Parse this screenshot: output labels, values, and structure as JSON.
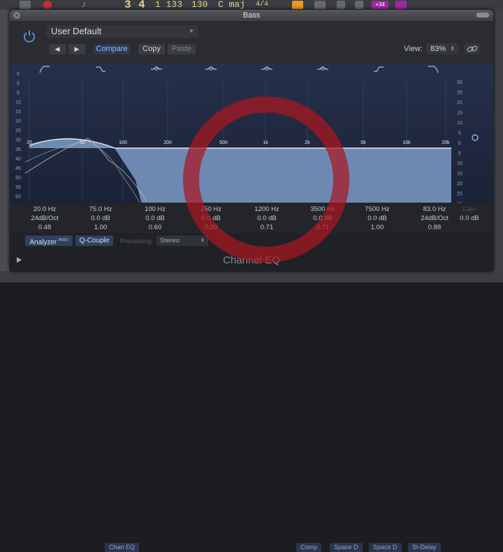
{
  "host": {
    "lcd": {
      "bar": "3",
      "beat": "4",
      "tempo": "1 133",
      "bpm": "130",
      "key": "C maj",
      "sig_top": "4",
      "sig_bottom": "4"
    },
    "badge": "+34",
    "strip_tabs": [
      "Chan EQ",
      "Comp",
      "Space D",
      "Space D",
      "St-Delay"
    ]
  },
  "window": {
    "title": "Bass"
  },
  "header": {
    "preset": "User Default",
    "prev_symbol": "◀",
    "next_symbol": "▶",
    "compare": "Compare",
    "copy": "Copy",
    "paste": "Paste",
    "view_label": "View:",
    "view_value": "83%",
    "view_arrows": "⬍"
  },
  "graph": {
    "y_left": [
      "0",
      "0",
      "5",
      "10",
      "15",
      "20",
      "25",
      "30",
      "35",
      "40",
      "45",
      "50",
      "55",
      "60"
    ],
    "y_right": [
      "30",
      "25",
      "20",
      "15",
      "10",
      "5",
      "0",
      "5",
      "10",
      "15",
      "20",
      "25",
      "30"
    ],
    "freq_labels": [
      "20",
      "50",
      "100",
      "200",
      "500",
      "1k",
      "2k",
      "5k",
      "10k",
      "20k"
    ],
    "band_icons": [
      "low-cut-icon",
      "low-shelf-icon",
      "bell-icon",
      "bell-icon",
      "bell-icon",
      "bell-icon",
      "high-shelf-icon",
      "high-cut-icon"
    ]
  },
  "bands": [
    {
      "freq": "20.0 Hz",
      "gain": "24dB/Oct",
      "q": "0.48"
    },
    {
      "freq": "75.0 Hz",
      "gain": "0.0 dB",
      "q": "1.00"
    },
    {
      "freq": "100 Hz",
      "gain": "0.0 dB",
      "q": "0.60"
    },
    {
      "freq": "250 Hz",
      "gain": "0.0 dB",
      "q": "0.30"
    },
    {
      "freq": "1200 Hz",
      "gain": "0.0 dB",
      "q": "0.71"
    },
    {
      "freq": "3500 Hz",
      "gain": "0.0 dB",
      "q": "0.71"
    },
    {
      "freq": "7500 Hz",
      "gain": "0.0 dB",
      "q": "1.00"
    },
    {
      "freq": "83.0 Hz",
      "gain": "24dB/Oct",
      "q": "0.88"
    }
  ],
  "master": {
    "label": "Gain",
    "value": "0.0 dB"
  },
  "footer": {
    "analyzer": "Analyzer",
    "analyzer_mode": "POST",
    "qcouple": "Q-Couple",
    "processing_label": "Processing:",
    "processing_value": "Stereo",
    "plugin_name": "Channel EQ"
  },
  "colors": {
    "accent": "#4f8de0",
    "eq_fill": "#7b9bc8",
    "overlay_ring": "#aa1620"
  }
}
